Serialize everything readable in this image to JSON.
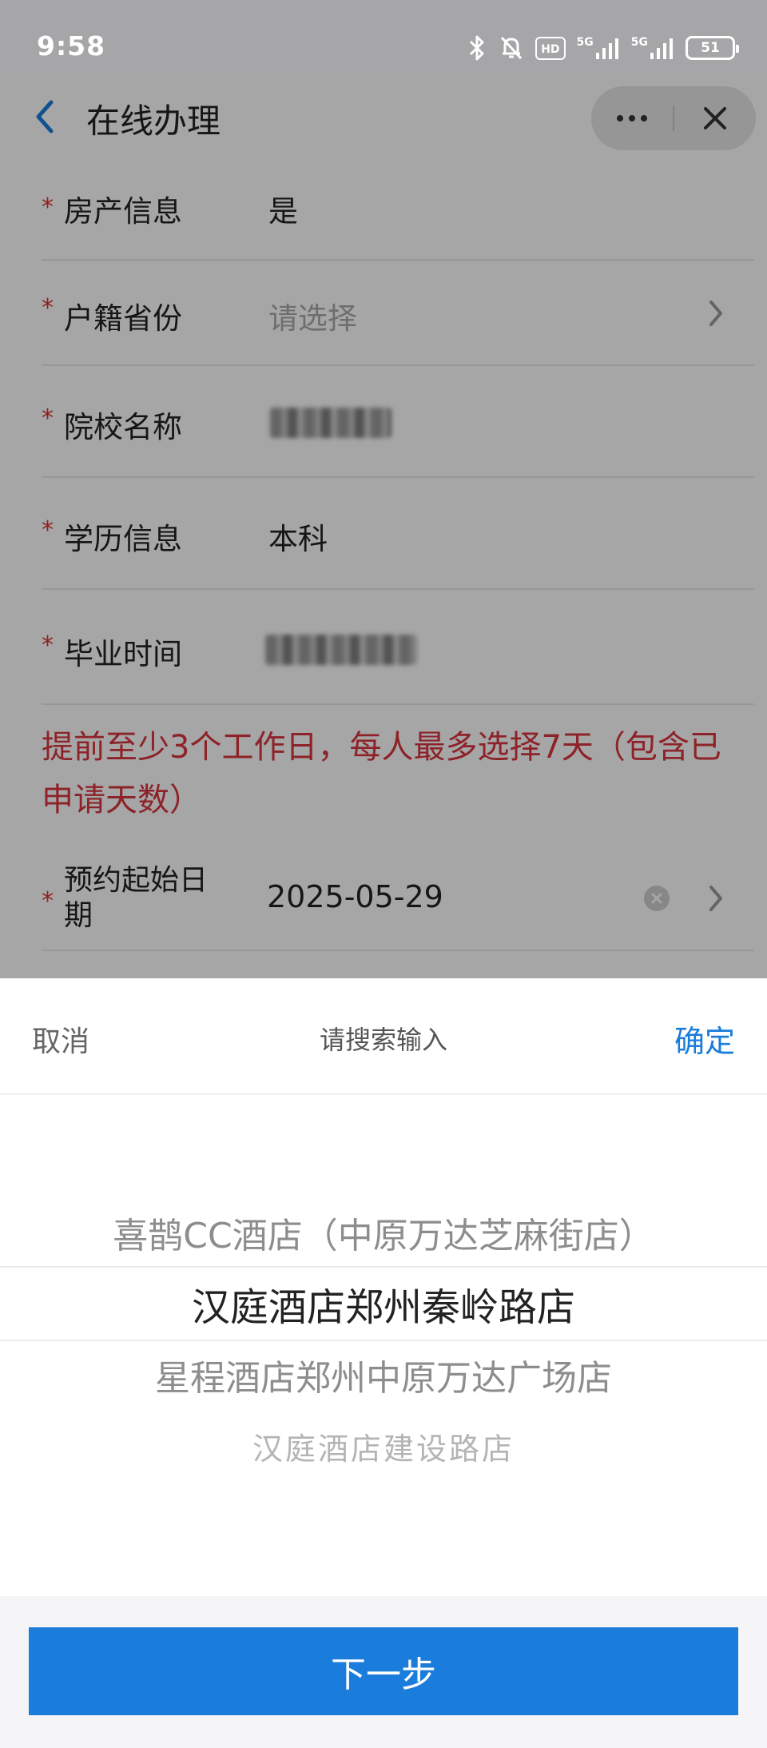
{
  "status_bar": {
    "time": "9:58",
    "icons": [
      "bluetooth-icon",
      "mute-bell-icon",
      "hd-icon",
      "signal-5g-icon",
      "signal-5g-icon"
    ],
    "hd_label": "HD",
    "net1": "5G",
    "net2": "5G",
    "battery": "51"
  },
  "nav": {
    "title": "在线办理",
    "back_icon": "chevron-left-icon",
    "more_icon": "more-dots-icon",
    "close_icon": "close-icon"
  },
  "form": {
    "rows": [
      {
        "label": "房产信息",
        "value": "是",
        "required": true
      },
      {
        "label": "户籍省份",
        "placeholder": "请选择",
        "required": true,
        "has_chevron": true
      },
      {
        "label": "院校名称",
        "value_blurred": true,
        "required": true
      },
      {
        "label": "学历信息",
        "value": "本科",
        "required": true
      },
      {
        "label": "毕业时间",
        "value_blurred": true,
        "required": true
      }
    ],
    "notice": "提前至少3个工作日，每人最多选择7天（包含已申请天数）",
    "start_date": {
      "label": "预约起始日期",
      "value": "2025-05-29",
      "required": true
    }
  },
  "picker": {
    "cancel": "取消",
    "search_placeholder": "请搜索输入",
    "confirm": "确定",
    "options": [
      "喜鹊CC酒店（中原万达芝麻街店）",
      "汉庭酒店郑州秦岭路店",
      "星程酒店郑州中原万达广场店",
      "汉庭酒店建设路店"
    ],
    "selected_index": 1
  },
  "footer": {
    "next_label": "下一步"
  },
  "colors": {
    "accent": "#1a7ddb",
    "required": "#e03131",
    "notice": "#d9363e",
    "overlay": "rgba(0,0,0,0.35)"
  }
}
